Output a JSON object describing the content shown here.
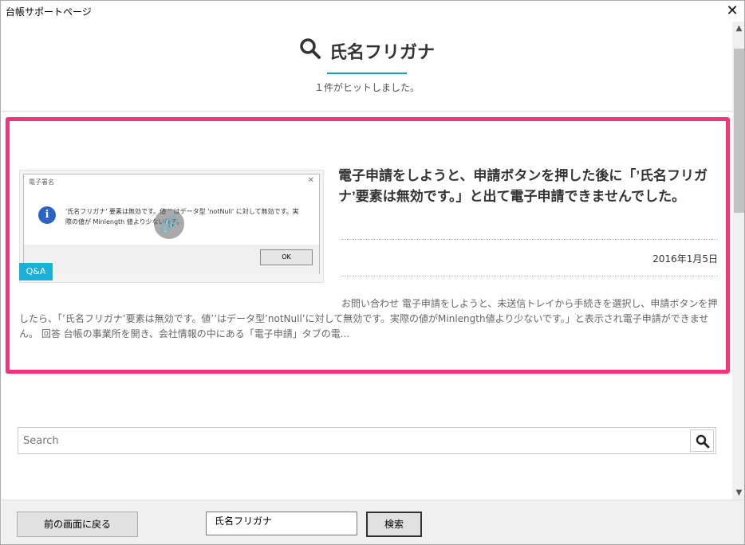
{
  "window": {
    "title": "台帳サポートページ",
    "close_glyph": "✕"
  },
  "page": {
    "title": "氏名フリガナ",
    "hit_count": "１件がヒットしました。"
  },
  "result": {
    "title": "電子申請をしようと、申請ボタンを押した後に「’氏名フリガナ’要素は無効です。」と出て電子申請できませんでした。",
    "date": "2016年1月5日",
    "excerpt": "お問い合わせ 電子申請をしようと、未送信トレイから手続きを選択し、申請ボタンを押したら、「’氏名フリガナ’要素は無効です。値’’はデータ型’notNull’に対して無効です。実際の値がMinlength値より少ないです。」と表示され電子申請ができません。 回答 台帳の事業所を開き、会社情報の中にある「電子申請」タブの電...",
    "badge": "Q&A",
    "thumbnail": {
      "dialog_title": "電子署名",
      "dialog_close": "✕",
      "info_glyph": "i",
      "message": "'氏名フリガナ' 要素は無効です。値 '' はデータ型 'notNull' に対して無効です。実際の値が Minlength 値より少ないです。",
      "ok_label": "OK",
      "link_glyph": "🔗"
    }
  },
  "search": {
    "placeholder": "Search"
  },
  "bottom": {
    "back_label": "前の画面に戻る",
    "keyword_value": "氏名フリガナ",
    "search_label": "検索"
  },
  "scroll": {
    "up_glyph": "▲",
    "down_glyph": "▼"
  },
  "colors": {
    "accent": "#1a9bcf",
    "highlight_border": "#f0357a",
    "badge": "#1ab0d8"
  }
}
